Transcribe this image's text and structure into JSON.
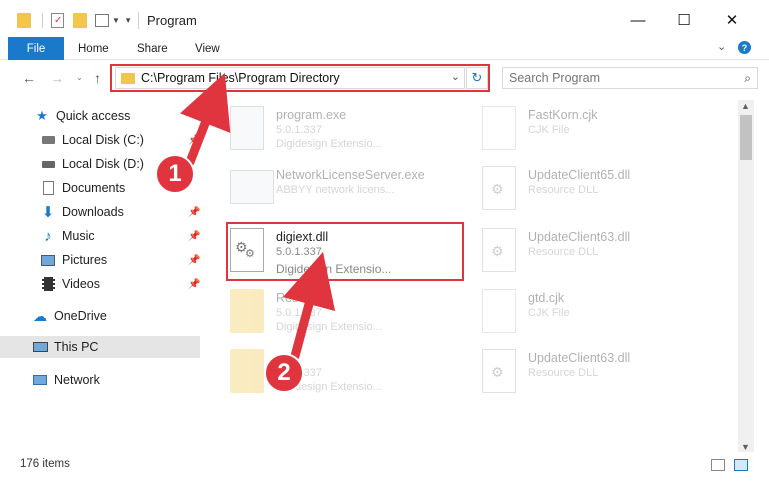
{
  "window": {
    "title": "Program",
    "minimize": "—",
    "maximize": "☐",
    "close": "✕"
  },
  "ribbon": {
    "file": "File",
    "home": "Home",
    "share": "Share",
    "view": "View",
    "help": "?"
  },
  "address": {
    "path": "C:\\Program Files\\Program Directory"
  },
  "search": {
    "placeholder": "Search Program"
  },
  "sidebar": {
    "items": [
      {
        "label": "Quick access"
      },
      {
        "label": "Local Disk (C:)"
      },
      {
        "label": "Local Disk (D:)"
      },
      {
        "label": "Documents"
      },
      {
        "label": "Downloads"
      },
      {
        "label": "Music"
      },
      {
        "label": "Pictures"
      },
      {
        "label": "Videos"
      },
      {
        "label": "OneDrive"
      },
      {
        "label": "This PC"
      },
      {
        "label": "Network"
      }
    ]
  },
  "files": [
    {
      "name": "program.exe",
      "line1": "5.0.1.337",
      "line2": "Digidesign Extensio..."
    },
    {
      "name": "NetworkLicenseServer.exe",
      "line1": "ABBYY network licens...",
      "line2": ""
    },
    {
      "name": "digiext.dll",
      "line1": "5.0.1.337",
      "line2": "Digidesign Extensio..."
    },
    {
      "name": "Resource",
      "line1": "5.0.1.337",
      "line2": "Digidesign Extensio..."
    },
    {
      "name": "",
      "line1": "5.0.1.337",
      "line2": "Digidesign Extensio..."
    },
    {
      "name": "FastKorn.cjk",
      "line1": "CJK File",
      "line2": ""
    },
    {
      "name": "UpdateClient65.dll",
      "line1": "Resource DLL",
      "line2": ""
    },
    {
      "name": "UpdateClient63.dll",
      "line1": "Resource DLL",
      "line2": ""
    },
    {
      "name": "gtd.cjk",
      "line1": "CJK File",
      "line2": ""
    },
    {
      "name": "UpdateClient63.dll",
      "line1": "Resource DLL",
      "line2": ""
    }
  ],
  "status": {
    "count": "176 items"
  },
  "callouts": {
    "one": "1",
    "two": "2"
  },
  "colors": {
    "accent": "#1979ca",
    "highlight": "#e0343f"
  }
}
